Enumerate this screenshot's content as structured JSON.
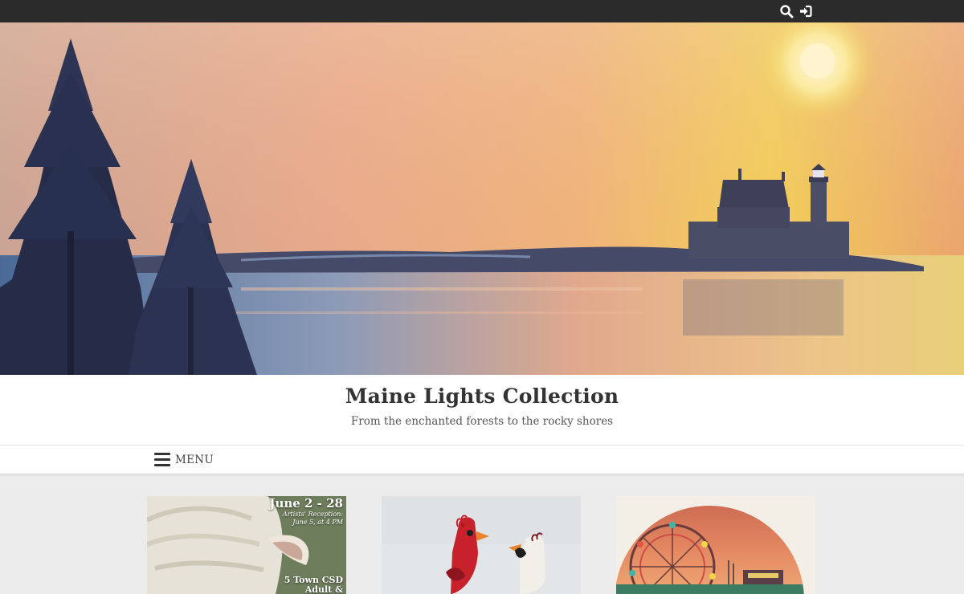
{
  "topbar": {
    "icons": [
      "search-icon",
      "sign-in-icon"
    ]
  },
  "hero": {
    "image": "painting of pine trees, a lighthouse on a rocky island and a sunset sky"
  },
  "site": {
    "title": "Maine Lights Collection",
    "description": "From the enchanted forests to the rocky shores"
  },
  "nav": {
    "menu_label": "MENU"
  },
  "cards": [
    {
      "image": "sheep painting event poster",
      "dates": "June 2 - 28",
      "reception_line1": "Artists' Reception:",
      "reception_line2": "June 5, at 4 PM",
      "show_line1": "5 Town CSD",
      "show_line2": "Adult &"
    },
    {
      "image": "red and white cardinal figurines"
    },
    {
      "image": "ferris wheel at sunset"
    }
  ],
  "colors": {
    "topbar": "#2b2b2b",
    "page_background": "#ececec",
    "title_text": "#333333"
  }
}
